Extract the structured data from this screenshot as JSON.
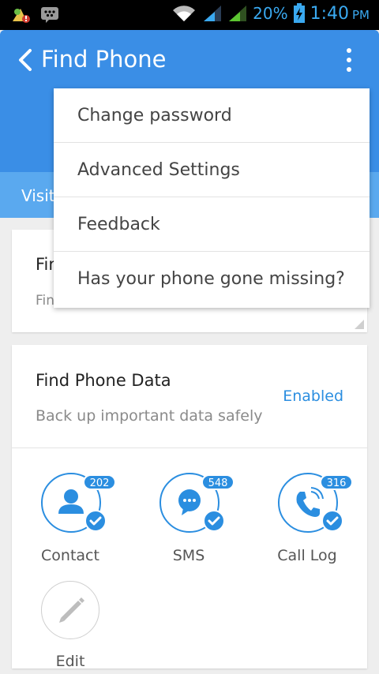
{
  "status_bar": {
    "battery_percent": "20%",
    "time": "1:40",
    "ampm": "PM"
  },
  "app_bar": {
    "title": "Find Phone",
    "tab_visible_text": "Visit"
  },
  "menu": {
    "items": [
      {
        "label": "Change password"
      },
      {
        "label": "Advanced Settings"
      },
      {
        "label": "Feedback"
      },
      {
        "label": "Has your phone gone missing?"
      }
    ]
  },
  "card_top": {
    "title_visible": "Fin",
    "subtitle_visible": "Fin"
  },
  "find_phone_data": {
    "title": "Find Phone Data",
    "subtitle": "Back up important data safely",
    "status": "Enabled",
    "features": [
      {
        "label": "Contact",
        "count": "202",
        "icon": "contact-icon"
      },
      {
        "label": "SMS",
        "count": "548",
        "icon": "sms-icon"
      },
      {
        "label": "Call Log",
        "count": "316",
        "icon": "phone-icon"
      }
    ],
    "edit_label": "Edit"
  },
  "colors": {
    "primary": "#3a8ee6",
    "accent": "#2b8ee0",
    "status_text": "#3aa9f0"
  }
}
